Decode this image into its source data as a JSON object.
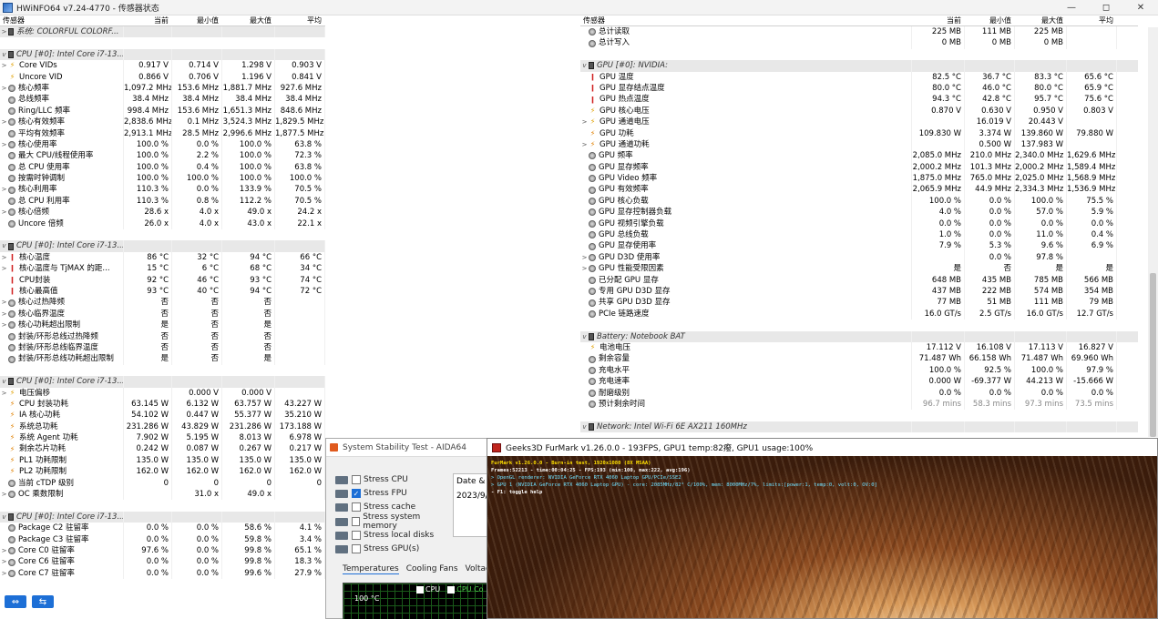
{
  "window": {
    "title": "HWiNFO64 v7.24-4770 - 传感器状态",
    "controls": [
      "—",
      "◻",
      "✕"
    ]
  },
  "headers": {
    "sensor": "传感器",
    "current": "当前",
    "min": "最小值",
    "max": "最大值",
    "avg": "平均"
  },
  "left_rows": [
    {
      "t": "grp",
      "ex": ">",
      "icon": "chip",
      "name": "系统: COLORFUL COLORF..."
    },
    {
      "t": "blank"
    },
    {
      "t": "grp",
      "ex": "v",
      "icon": "chip",
      "name": "CPU [#0]: Intel Core i7-13..."
    },
    {
      "t": "row",
      "ex": ">",
      "icon": "volt",
      "name": "Core VIDs",
      "v": [
        "0.917 V",
        "0.714 V",
        "1.298 V",
        "0.903 V"
      ]
    },
    {
      "t": "row",
      "ex": "",
      "icon": "volt",
      "name": "Uncore VID",
      "v": [
        "0.866 V",
        "0.706 V",
        "1.196 V",
        "0.841 V"
      ]
    },
    {
      "t": "row",
      "ex": ">",
      "icon": "circ",
      "name": "核心频率",
      "v": [
        "1,097.2 MHz",
        "153.6 MHz",
        "1,881.7 MHz",
        "927.6 MHz"
      ]
    },
    {
      "t": "row",
      "ex": "",
      "icon": "circ",
      "name": "总线频率",
      "v": [
        "38.4 MHz",
        "38.4 MHz",
        "38.4 MHz",
        "38.4 MHz"
      ]
    },
    {
      "t": "row",
      "ex": "",
      "icon": "circ",
      "name": "Ring/LLC 频率",
      "v": [
        "998.4 MHz",
        "153.6 MHz",
        "1,651.3 MHz",
        "848.6 MHz"
      ]
    },
    {
      "t": "row",
      "ex": ">",
      "icon": "circ",
      "name": "核心有效频率",
      "v": [
        "2,838.6 MHz",
        "0.1 MHz",
        "3,524.3 MHz",
        "1,829.5 MHz"
      ]
    },
    {
      "t": "row",
      "ex": "",
      "icon": "circ",
      "name": "平均有效频率",
      "v": [
        "2,913.1 MHz",
        "28.5 MHz",
        "2,996.6 MHz",
        "1,877.5 MHz"
      ]
    },
    {
      "t": "row",
      "ex": ">",
      "icon": "circ",
      "name": "核心使用率",
      "v": [
        "100.0 %",
        "0.0 %",
        "100.0 %",
        "63.8 %"
      ]
    },
    {
      "t": "row",
      "ex": "",
      "icon": "circ",
      "name": "最大 CPU/线程使用率",
      "v": [
        "100.0 %",
        "2.2 %",
        "100.0 %",
        "72.3 %"
      ]
    },
    {
      "t": "row",
      "ex": "",
      "icon": "circ",
      "name": "总 CPU 使用率",
      "v": [
        "100.0 %",
        "0.4 %",
        "100.0 %",
        "63.8 %"
      ]
    },
    {
      "t": "row",
      "ex": "",
      "icon": "circ",
      "name": "按需时钟调制",
      "v": [
        "100.0 %",
        "100.0 %",
        "100.0 %",
        "100.0 %"
      ]
    },
    {
      "t": "row",
      "ex": ">",
      "icon": "circ",
      "name": "核心利用率",
      "v": [
        "110.3 %",
        "0.0 %",
        "133.9 %",
        "70.5 %"
      ]
    },
    {
      "t": "row",
      "ex": "",
      "icon": "circ",
      "name": "总 CPU 利用率",
      "v": [
        "110.3 %",
        "0.8 %",
        "112.2 %",
        "70.5 %"
      ]
    },
    {
      "t": "row",
      "ex": ">",
      "icon": "circ",
      "name": "核心倍频",
      "v": [
        "28.6 x",
        "4.0 x",
        "49.0 x",
        "24.2 x"
      ]
    },
    {
      "t": "row",
      "ex": "",
      "icon": "circ",
      "name": "Uncore 倍频",
      "v": [
        "26.0 x",
        "4.0 x",
        "43.0 x",
        "22.1 x"
      ]
    },
    {
      "t": "blank"
    },
    {
      "t": "grp",
      "ex": "v",
      "icon": "chip",
      "name": "CPU [#0]: Intel Core i7-13..."
    },
    {
      "t": "row",
      "ex": ">",
      "icon": "temp",
      "name": "核心温度",
      "v": [
        "86 °C",
        "32 °C",
        "94 °C",
        "66 °C"
      ]
    },
    {
      "t": "row",
      "ex": ">",
      "icon": "temp",
      "name": "核心温度与 TjMAX 的距...",
      "v": [
        "15 °C",
        "6 °C",
        "68 °C",
        "34 °C"
      ]
    },
    {
      "t": "row",
      "ex": "",
      "icon": "temp",
      "name": "CPU封装",
      "v": [
        "92 °C",
        "46 °C",
        "93 °C",
        "74 °C"
      ]
    },
    {
      "t": "row",
      "ex": "",
      "icon": "temp",
      "name": "核心最高值",
      "v": [
        "93 °C",
        "40 °C",
        "94 °C",
        "72 °C"
      ]
    },
    {
      "t": "row",
      "ex": ">",
      "icon": "circ",
      "name": "核心过热降频",
      "v": [
        "否",
        "否",
        "否",
        ""
      ]
    },
    {
      "t": "row",
      "ex": ">",
      "icon": "circ",
      "name": "核心临界温度",
      "v": [
        "否",
        "否",
        "否",
        ""
      ]
    },
    {
      "t": "row",
      "ex": ">",
      "icon": "circ",
      "name": "核心功耗超出限制",
      "v": [
        "是",
        "否",
        "是",
        ""
      ]
    },
    {
      "t": "row",
      "ex": "",
      "icon": "circ",
      "name": "封装/环形总线过热降频",
      "v": [
        "否",
        "否",
        "否",
        ""
      ]
    },
    {
      "t": "row",
      "ex": "",
      "icon": "circ",
      "name": "封装/环形总线临界温度",
      "v": [
        "否",
        "否",
        "否",
        ""
      ]
    },
    {
      "t": "row",
      "ex": "",
      "icon": "circ",
      "name": "封装/环形总线功耗超出限制",
      "v": [
        "是",
        "否",
        "是",
        ""
      ]
    },
    {
      "t": "blank"
    },
    {
      "t": "grp",
      "ex": "v",
      "icon": "chip",
      "name": "CPU [#0]: Intel Core i7-13..."
    },
    {
      "t": "row",
      "ex": ">",
      "icon": "volt",
      "name": "电压偏移",
      "v": [
        "",
        "0.000 V",
        "0.000 V",
        ""
      ]
    },
    {
      "t": "row",
      "ex": "",
      "icon": "pow",
      "name": "CPU 封装功耗",
      "v": [
        "63.145 W",
        "6.132 W",
        "63.757 W",
        "43.227 W"
      ]
    },
    {
      "t": "row",
      "ex": "",
      "icon": "pow",
      "name": "IA 核心功耗",
      "v": [
        "54.102 W",
        "0.447 W",
        "55.377 W",
        "35.210 W"
      ]
    },
    {
      "t": "row",
      "ex": "",
      "icon": "pow",
      "name": "系统总功耗",
      "v": [
        "231.286 W",
        "43.829 W",
        "231.286 W",
        "173.188 W"
      ]
    },
    {
      "t": "row",
      "ex": "",
      "icon": "pow",
      "name": "系统 Agent 功耗",
      "v": [
        "7.902 W",
        "5.195 W",
        "8.013 W",
        "6.978 W"
      ]
    },
    {
      "t": "row",
      "ex": "",
      "icon": "pow",
      "name": "剩余芯片功耗",
      "v": [
        "0.242 W",
        "0.087 W",
        "0.267 W",
        "0.217 W"
      ]
    },
    {
      "t": "row",
      "ex": "",
      "icon": "pow",
      "name": "PL1 功耗限制",
      "v": [
        "135.0 W",
        "135.0 W",
        "135.0 W",
        "135.0 W"
      ]
    },
    {
      "t": "row",
      "ex": "",
      "icon": "pow",
      "name": "PL2 功耗限制",
      "v": [
        "162.0 W",
        "162.0 W",
        "162.0 W",
        "162.0 W"
      ]
    },
    {
      "t": "row",
      "ex": "",
      "icon": "circ",
      "name": "当前 cTDP 级别",
      "v": [
        "0",
        "0",
        "0",
        "0"
      ]
    },
    {
      "t": "row",
      "ex": ">",
      "icon": "circ",
      "name": "OC 乘数限制",
      "v": [
        "",
        "31.0 x",
        "49.0 x",
        ""
      ]
    },
    {
      "t": "blank"
    },
    {
      "t": "grp",
      "ex": "v",
      "icon": "chip",
      "name": "CPU [#0]: Intel Core i7-13..."
    },
    {
      "t": "row",
      "ex": "",
      "icon": "circ",
      "name": "Package C2 驻留率",
      "v": [
        "0.0 %",
        "0.0 %",
        "58.6 %",
        "4.1 %"
      ]
    },
    {
      "t": "row",
      "ex": "",
      "icon": "circ",
      "name": "Package C3 驻留率",
      "v": [
        "0.0 %",
        "0.0 %",
        "59.8 %",
        "3.4 %"
      ]
    },
    {
      "t": "row",
      "ex": ">",
      "icon": "circ",
      "name": "Core C0 驻留率",
      "v": [
        "97.6 %",
        "0.0 %",
        "99.8 %",
        "65.1 %"
      ]
    },
    {
      "t": "row",
      "ex": ">",
      "icon": "circ",
      "name": "Core C6 驻留率",
      "v": [
        "0.0 %",
        "0.0 %",
        "99.8 %",
        "18.3 %"
      ]
    },
    {
      "t": "row",
      "ex": ">",
      "icon": "circ",
      "name": "Core C7 驻留率",
      "v": [
        "0.0 %",
        "0.0 %",
        "99.6 %",
        "27.9 %"
      ]
    }
  ],
  "right_rows": [
    {
      "t": "row",
      "ex": "",
      "icon": "circ",
      "name": "总计读取",
      "v": [
        "225 MB",
        "111 MB",
        "225 MB",
        ""
      ]
    },
    {
      "t": "row",
      "ex": "",
      "icon": "circ",
      "name": "总计写入",
      "v": [
        "0 MB",
        "0 MB",
        "0 MB",
        ""
      ]
    },
    {
      "t": "blank"
    },
    {
      "t": "grp",
      "ex": "v",
      "icon": "chip",
      "name": "GPU [#0]: NVIDIA:"
    },
    {
      "t": "row",
      "ex": "",
      "icon": "temp",
      "name": "GPU 温度",
      "v": [
        "82.5 °C",
        "36.7 °C",
        "83.3 °C",
        "65.6 °C"
      ]
    },
    {
      "t": "row",
      "ex": "",
      "icon": "temp",
      "name": "GPU 显存结点温度",
      "v": [
        "80.0 °C",
        "46.0 °C",
        "80.0 °C",
        "65.9 °C"
      ]
    },
    {
      "t": "row",
      "ex": "",
      "icon": "temp",
      "name": "GPU 热点温度",
      "v": [
        "94.3 °C",
        "42.8 °C",
        "95.7 °C",
        "75.6 °C"
      ]
    },
    {
      "t": "row",
      "ex": "",
      "icon": "volt",
      "name": "GPU 核心电压",
      "v": [
        "0.870 V",
        "0.630 V",
        "0.950 V",
        "0.803 V"
      ]
    },
    {
      "t": "row",
      "ex": ">",
      "icon": "volt",
      "name": "GPU 通道电压",
      "v": [
        "",
        "16.019 V",
        "20.443 V",
        ""
      ]
    },
    {
      "t": "row",
      "ex": "",
      "icon": "pow",
      "name": "GPU 功耗",
      "v": [
        "109.830 W",
        "3.374 W",
        "139.860 W",
        "79.880 W"
      ]
    },
    {
      "t": "row",
      "ex": ">",
      "icon": "pow",
      "name": "GPU 通道功耗",
      "v": [
        "",
        "0.500 W",
        "137.983 W",
        ""
      ]
    },
    {
      "t": "row",
      "ex": "",
      "icon": "circ",
      "name": "GPU 频率",
      "v": [
        "2,085.0 MHz",
        "210.0 MHz",
        "2,340.0 MHz",
        "1,629.6 MHz"
      ]
    },
    {
      "t": "row",
      "ex": "",
      "icon": "circ",
      "name": "GPU 显存频率",
      "v": [
        "2,000.2 MHz",
        "101.3 MHz",
        "2,000.2 MHz",
        "1,589.4 MHz"
      ]
    },
    {
      "t": "row",
      "ex": "",
      "icon": "circ",
      "name": "GPU Video 频率",
      "v": [
        "1,875.0 MHz",
        "765.0 MHz",
        "2,025.0 MHz",
        "1,568.9 MHz"
      ]
    },
    {
      "t": "row",
      "ex": "",
      "icon": "circ",
      "name": "GPU 有效频率",
      "v": [
        "2,065.9 MHz",
        "44.9 MHz",
        "2,334.3 MHz",
        "1,536.9 MHz"
      ]
    },
    {
      "t": "row",
      "ex": "",
      "icon": "circ",
      "name": "GPU 核心负载",
      "v": [
        "100.0 %",
        "0.0 %",
        "100.0 %",
        "75.5 %"
      ]
    },
    {
      "t": "row",
      "ex": "",
      "icon": "circ",
      "name": "GPU 显存控制器负载",
      "v": [
        "4.0 %",
        "0.0 %",
        "57.0 %",
        "5.9 %"
      ]
    },
    {
      "t": "row",
      "ex": "",
      "icon": "circ",
      "name": "GPU 视频引擎负载",
      "v": [
        "0.0 %",
        "0.0 %",
        "0.0 %",
        "0.0 %"
      ]
    },
    {
      "t": "row",
      "ex": "",
      "icon": "circ",
      "name": "GPU 总线负载",
      "v": [
        "1.0 %",
        "0.0 %",
        "11.0 %",
        "0.4 %"
      ]
    },
    {
      "t": "row",
      "ex": "",
      "icon": "circ",
      "name": "GPU 显存使用率",
      "v": [
        "7.9 %",
        "5.3 %",
        "9.6 %",
        "6.9 %"
      ]
    },
    {
      "t": "row",
      "ex": ">",
      "icon": "circ",
      "name": "GPU D3D 使用率",
      "v": [
        "",
        "0.0 %",
        "97.8 %",
        ""
      ]
    },
    {
      "t": "row",
      "ex": ">",
      "icon": "circ",
      "name": "GPU 性能受限因素",
      "v": [
        "是",
        "否",
        "是",
        "是"
      ]
    },
    {
      "t": "row",
      "ex": "",
      "icon": "circ",
      "name": "已分配 GPU 显存",
      "v": [
        "648 MB",
        "435 MB",
        "785 MB",
        "566 MB"
      ]
    },
    {
      "t": "row",
      "ex": "",
      "icon": "circ",
      "name": "专用 GPU D3D 显存",
      "v": [
        "437 MB",
        "222 MB",
        "574 MB",
        "354 MB"
      ]
    },
    {
      "t": "row",
      "ex": "",
      "icon": "circ",
      "name": "共享 GPU D3D 显存",
      "v": [
        "77 MB",
        "51 MB",
        "111 MB",
        "79 MB"
      ]
    },
    {
      "t": "row",
      "ex": "",
      "icon": "circ",
      "name": "PCIe 链路速度",
      "v": [
        "16.0 GT/s",
        "2.5 GT/s",
        "16.0 GT/s",
        "12.7 GT/s"
      ]
    },
    {
      "t": "blank"
    },
    {
      "t": "grp",
      "ex": "v",
      "icon": "chip",
      "name": "Battery: Notebook BAT"
    },
    {
      "t": "row",
      "ex": "",
      "icon": "volt",
      "name": "电池电压",
      "v": [
        "17.112 V",
        "16.108 V",
        "17.113 V",
        "16.827 V"
      ]
    },
    {
      "t": "row",
      "ex": "",
      "icon": "circ",
      "name": "剩余容量",
      "v": [
        "71.487 Wh",
        "66.158 Wh",
        "71.487 Wh",
        "69.960 Wh"
      ]
    },
    {
      "t": "row",
      "ex": "",
      "icon": "circ",
      "name": "充电水平",
      "v": [
        "100.0 %",
        "92.5 %",
        "100.0 %",
        "97.9 %"
      ]
    },
    {
      "t": "row",
      "ex": "",
      "icon": "circ",
      "name": "充电速率",
      "v": [
        "0.000 W",
        "-69.377 W",
        "44.213 W",
        "-15.666 W"
      ]
    },
    {
      "t": "row",
      "ex": "",
      "icon": "circ",
      "name": "耐磨级别",
      "v": [
        "0.0 %",
        "0.0 %",
        "0.0 %",
        "0.0 %"
      ]
    },
    {
      "t": "row",
      "ex": "",
      "icon": "circ",
      "name": "预计剩余时间",
      "v": [
        "96.7 mins",
        "58.3 mins",
        "97.3 mins",
        "73.5 mins"
      ],
      "grey": true
    },
    {
      "t": "blank"
    },
    {
      "t": "grp",
      "ex": "v",
      "icon": "wifi",
      "name": "Network: Intel Wi-Fi 6E AX211 160MHz"
    }
  ],
  "footer": {
    "left_arrows": "⇔",
    "right_arrows": "⇆"
  },
  "aida": {
    "title": "System Stability Test - AIDA64",
    "checks": [
      {
        "label": "Stress CPU",
        "on": false
      },
      {
        "label": "Stress FPU",
        "on": true
      },
      {
        "label": "Stress cache",
        "on": false
      },
      {
        "label": "Stress system memory",
        "on": false
      },
      {
        "label": "Stress local disks",
        "on": false
      },
      {
        "label": "Stress GPU(s)",
        "on": false
      }
    ],
    "date_header": "Date & T",
    "date_value": "2023/9/",
    "tabs": [
      "Temperatures",
      "Cooling Fans",
      "Voltages"
    ],
    "graph_label": "100 °C",
    "legend": [
      "CPU",
      "CPU Co"
    ]
  },
  "furmark": {
    "title": "Geeks3D FurMark v1.26.0.0 - 193FPS, GPU1 temp:82癈, GPU1 usage:100%",
    "osd": [
      {
        "cls": "y",
        "text": "FurMark v1.26.0.0 - Burn-in test, 1920x1080 (8X MSAA)"
      },
      {
        "cls": "w",
        "text": "Frames:52213 - time:00:04:25 - FPS:193 (min:100, max:222, avg:196)"
      },
      {
        "cls": "c",
        "text": "> OpenGL renderer: NVIDIA GeForce RTX 4060 Laptop GPU/PCIe/SSE2"
      },
      {
        "cls": "c",
        "text": "> GPU 1 (NVIDIA GeForce RTX 4060 Laptop GPU) - core: 2085MHz/82° C/100%, mem: 8000MHz/7%, limits:[power:1, temp:0, volt:0, OV:0]"
      },
      {
        "cls": "w",
        "text": "- F1: toggle help"
      }
    ]
  }
}
